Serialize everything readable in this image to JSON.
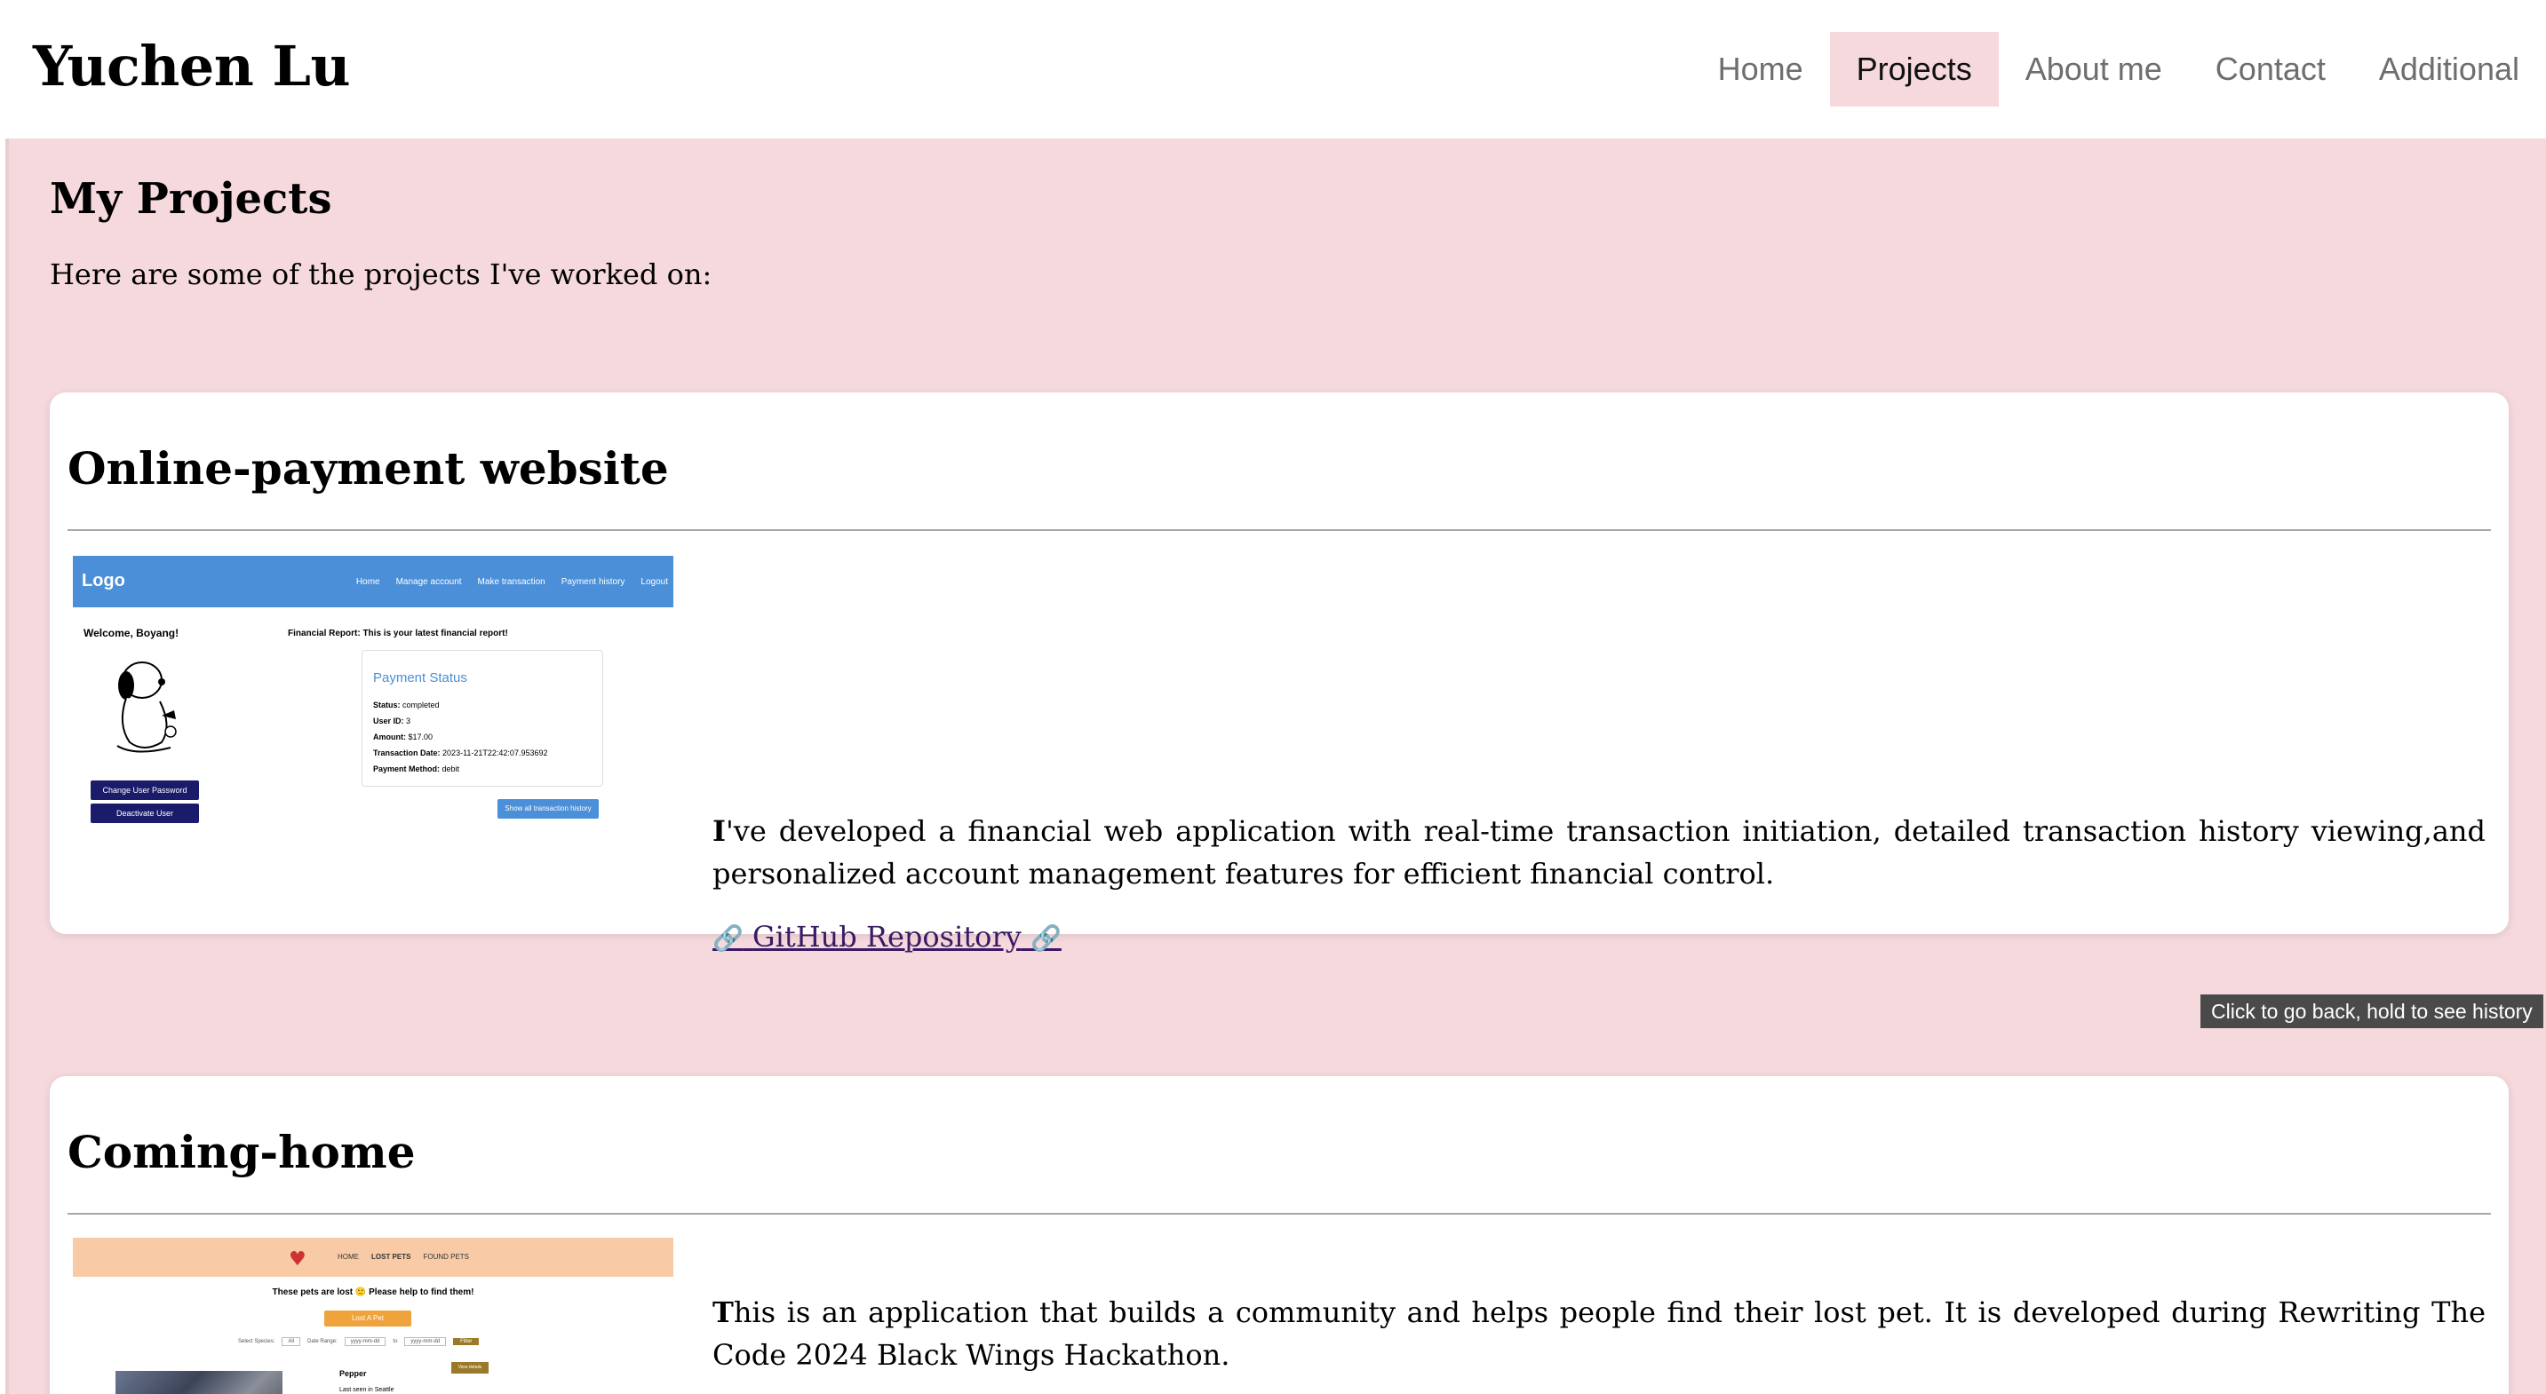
{
  "header": {
    "site_title": "Yuchen Lu",
    "nav": [
      {
        "label": "Home",
        "active": false
      },
      {
        "label": "Projects",
        "active": true
      },
      {
        "label": "About me",
        "active": false
      },
      {
        "label": "Contact",
        "active": false
      },
      {
        "label": "Additional",
        "active": false
      }
    ]
  },
  "main": {
    "heading": "My Projects",
    "intro": "Here are some of the projects I've worked on:"
  },
  "projects": [
    {
      "title": "Online-payment website",
      "desc_first": "I",
      "desc_rest": "'ve developed a financial web application with real-time transaction initiation, detailed transaction history viewing,and personalized account management features for efficient financial control.",
      "link_label": "GitHub Repository",
      "link_icon": "🔗",
      "thumbnail": {
        "logo": "Logo",
        "nav": [
          "Home",
          "Manage account",
          "Make transaction",
          "Payment history",
          "Logout"
        ],
        "welcome": "Welcome, Boyang!",
        "report": "Financial Report: This is your latest financial report!",
        "status_title": "Payment Status",
        "status_rows": [
          {
            "label": "Status:",
            "value": "completed"
          },
          {
            "label": "User ID:",
            "value": "3"
          },
          {
            "label": "Amount:",
            "value": "$17.00"
          },
          {
            "label": "Transaction Date:",
            "value": "2023-11-21T22:42:07.953692"
          },
          {
            "label": "Payment Method:",
            "value": "debit"
          }
        ],
        "buttons": [
          "Change User Password",
          "Deactivate User"
        ],
        "show_all": "Show all transaction history"
      }
    },
    {
      "title": "Coming-home",
      "desc_first": "T",
      "desc_rest": "his is an application that builds a community and helps people find their lost pet. It is developed during Rewriting The Code 2024 Black Wings Hackathon.",
      "thumbnail": {
        "nav": [
          "HOME",
          "LOST PETS",
          "FOUND PETS"
        ],
        "lost_text": "These pets are lost 🙁 Please help to find them!",
        "lost_button": "Lost A Pet",
        "filter_species": "Select Species:",
        "filter_species_val": "All",
        "filter_date": "Date Range:",
        "filter_from": "yyyy-mm-dd",
        "filter_to_word": "to",
        "filter_to": "yyyy-mm-dd",
        "filter_btn": "Filter",
        "pet_name": "Pepper",
        "pet_seen": "Last seen in Seattle",
        "details_btn": "View details"
      }
    }
  ],
  "tooltip": "Click to go back, hold to see history",
  "colors": {
    "page_background": "#f5d9dd",
    "active_nav": "#f5d9dd",
    "link": "#3b1a63"
  }
}
